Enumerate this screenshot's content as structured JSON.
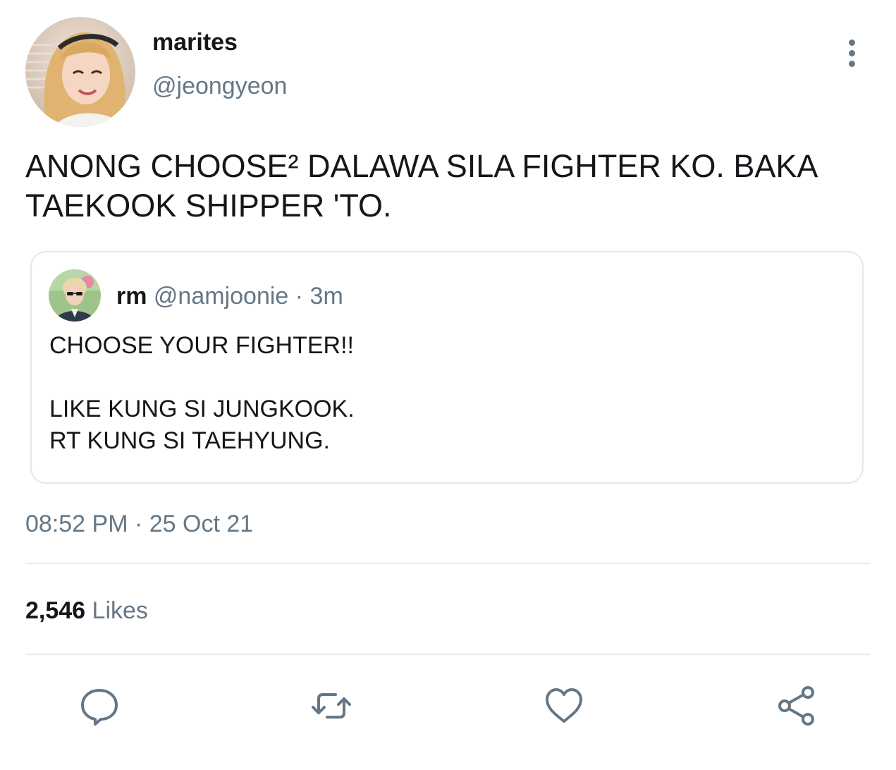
{
  "author": {
    "display_name": "marites",
    "handle": "@jeongyeon",
    "avatar": "profile-photo"
  },
  "tweet": {
    "text": "ANONG CHOOSE² DALAWA SILA FIGHTER KO. BAKA\nTAEKOOK SHIPPER 'TO."
  },
  "quoted_tweet": {
    "display_name": "rm",
    "handle_time": "@namjoonie · 3m",
    "text": "CHOOSE YOUR FIGHTER!!\n\nLIKE KUNG SI JUNGKOOK.\nRT KUNG SI TAEHYUNG."
  },
  "timestamp": "08:52 PM · 25 Oct 21",
  "stats": {
    "likes_count": "2,546",
    "likes_label": "Likes"
  },
  "actions": [
    {
      "name": "reply",
      "icon": "speech-bubble-icon"
    },
    {
      "name": "retweet",
      "icon": "retweet-icon"
    },
    {
      "name": "like",
      "icon": "heart-icon"
    },
    {
      "name": "share",
      "icon": "share-icon"
    }
  ],
  "colors": {
    "text": "#14171a",
    "secondary": "#657786",
    "border": "#e1e8ed"
  }
}
